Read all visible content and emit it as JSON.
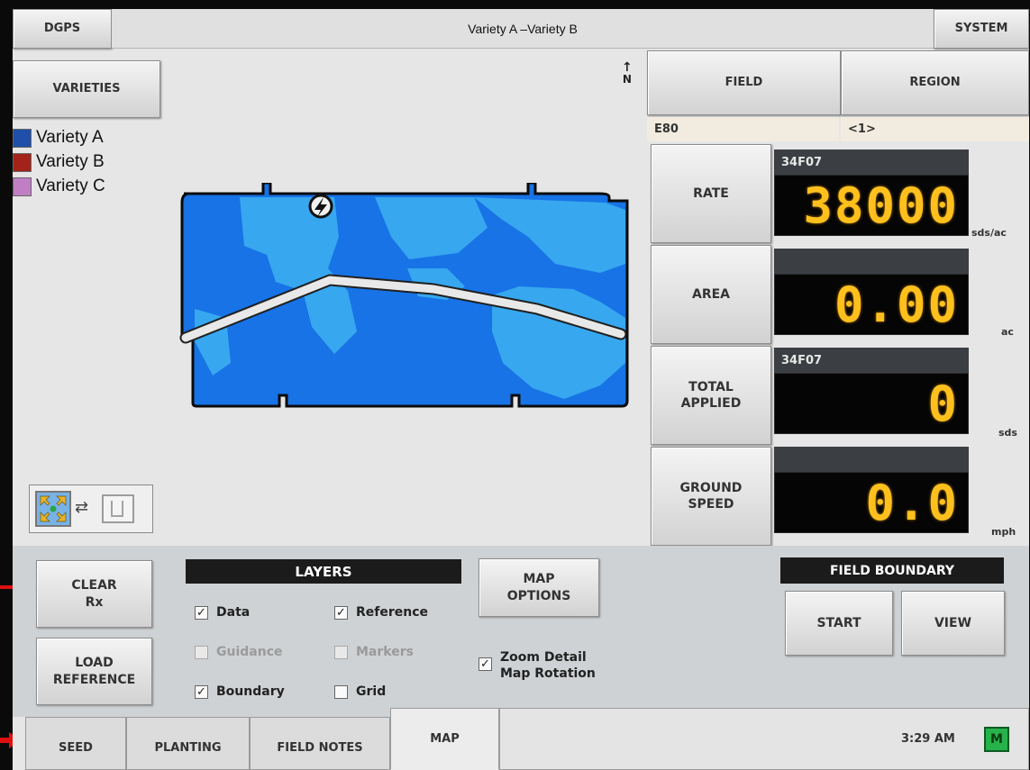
{
  "header": {
    "dgps_label": "DGPS",
    "title": "Variety A –Variety B",
    "system_label": "SYSTEM"
  },
  "map_panel": {
    "varieties_label": "VARIETIES",
    "north_label": "N",
    "legend": [
      {
        "label": "Variety A",
        "color": "#1f4fa8"
      },
      {
        "label": "Variety B",
        "color": "#a32219"
      },
      {
        "label": "Variety C",
        "color": "#c07fc4"
      }
    ],
    "map_colors": {
      "dark": "#1773e6",
      "light": "#37a7ef",
      "path": "#e8e8e8"
    },
    "view_toggle_icons": [
      "zoom-extents-icon",
      "swap-arrows-icon",
      "page-view-icon"
    ]
  },
  "right_panel": {
    "field_label": "FIELD",
    "region_label": "REGION",
    "field_value": "E80",
    "region_value": "<1>",
    "metrics": [
      {
        "label": "RATE",
        "header": "34F07",
        "value": "38000",
        "unit": "sds/ac"
      },
      {
        "label": "AREA",
        "header": "",
        "value": "0.00",
        "unit": "ac"
      },
      {
        "label": "TOTAL\nAPPLIED",
        "header": "34F07",
        "value": "0",
        "unit": "sds"
      },
      {
        "label": "GROUND\nSPEED",
        "header": "",
        "value": "0.0",
        "unit": "mph"
      }
    ]
  },
  "bottom_panel": {
    "clear_rx_label": "CLEAR\nRx",
    "load_reference_label": "LOAD\nREFERENCE",
    "layers_title": "LAYERS",
    "layers": [
      {
        "label": "Data",
        "checked": true,
        "enabled": true
      },
      {
        "label": "Reference",
        "checked": true,
        "enabled": true
      },
      {
        "label": "Guidance",
        "checked": false,
        "enabled": false
      },
      {
        "label": "Markers",
        "checked": false,
        "enabled": false
      },
      {
        "label": "Boundary",
        "checked": true,
        "enabled": true
      },
      {
        "label": "Grid",
        "checked": false,
        "enabled": true
      }
    ],
    "map_options_label": "MAP\nOPTIONS",
    "zoom_detail_label": "Zoom Detail\nMap Rotation",
    "zoom_detail_checked": true,
    "field_boundary_title": "FIELD BOUNDARY",
    "start_label": "START",
    "view_label": "VIEW"
  },
  "tabs": [
    {
      "label": "SEED",
      "active": false
    },
    {
      "label": "PLANTING",
      "active": false
    },
    {
      "label": "FIELD NOTES",
      "active": false
    },
    {
      "label": "MAP",
      "active": true
    }
  ],
  "status": {
    "time": "3:29 AM",
    "mode_badge": "M",
    "badge_color": "#27b24a"
  }
}
